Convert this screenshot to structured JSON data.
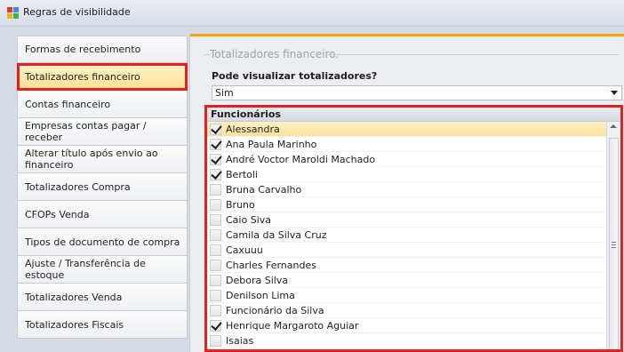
{
  "window": {
    "title": "Regras de visibilidade"
  },
  "nav": {
    "items": [
      {
        "label": "Formas de recebimento",
        "active": false
      },
      {
        "label": "Totalizadores financeiro",
        "active": true
      },
      {
        "label": "Contas financeiro",
        "active": false
      },
      {
        "label": "Empresas contas pagar / receber",
        "active": false
      },
      {
        "label": "Alterar título após envio ao financeiro",
        "active": false
      },
      {
        "label": "Totalizadores Compra",
        "active": false
      },
      {
        "label": "CFOPs Venda",
        "active": false
      },
      {
        "label": "Tipos de documento de compra",
        "active": false
      },
      {
        "label": "Ajuste / Transferência de estoque",
        "active": false
      },
      {
        "label": "Totalizadores Venda",
        "active": false
      },
      {
        "label": "Totalizadores Fiscais",
        "active": false
      }
    ]
  },
  "panel": {
    "group_title": "Totalizadores financeiro.",
    "question_label": "Pode visualizar totalizadores?",
    "select_value": "Sim",
    "list_header": "Funcionários",
    "employees": [
      {
        "name": "Alessandra",
        "checked": true,
        "selected": true
      },
      {
        "name": "Ana Paula Marinho",
        "checked": true,
        "selected": false
      },
      {
        "name": "André Voctor Maroldi Machado",
        "checked": true,
        "selected": false
      },
      {
        "name": "Bertoli",
        "checked": true,
        "selected": false
      },
      {
        "name": "Bruna Carvalho",
        "checked": false,
        "selected": false
      },
      {
        "name": "Bruno",
        "checked": false,
        "selected": false
      },
      {
        "name": "Caio Siva",
        "checked": false,
        "selected": false
      },
      {
        "name": "Camila da Silva Cruz",
        "checked": false,
        "selected": false
      },
      {
        "name": "Caxuuu",
        "checked": false,
        "selected": false
      },
      {
        "name": "Charles Fernandes",
        "checked": false,
        "selected": false
      },
      {
        "name": "Debora Silva",
        "checked": false,
        "selected": false
      },
      {
        "name": "Denilson Lima",
        "checked": false,
        "selected": false
      },
      {
        "name": "Funcionário da Silva",
        "checked": false,
        "selected": false
      },
      {
        "name": "Henrique Margaroto Aguiar",
        "checked": true,
        "selected": false
      },
      {
        "name": "Isaias",
        "checked": false,
        "selected": false
      }
    ]
  },
  "colors": {
    "highlight_border": "#e52020",
    "accent": "#f5a500",
    "selected_row": "#fbe19a"
  }
}
